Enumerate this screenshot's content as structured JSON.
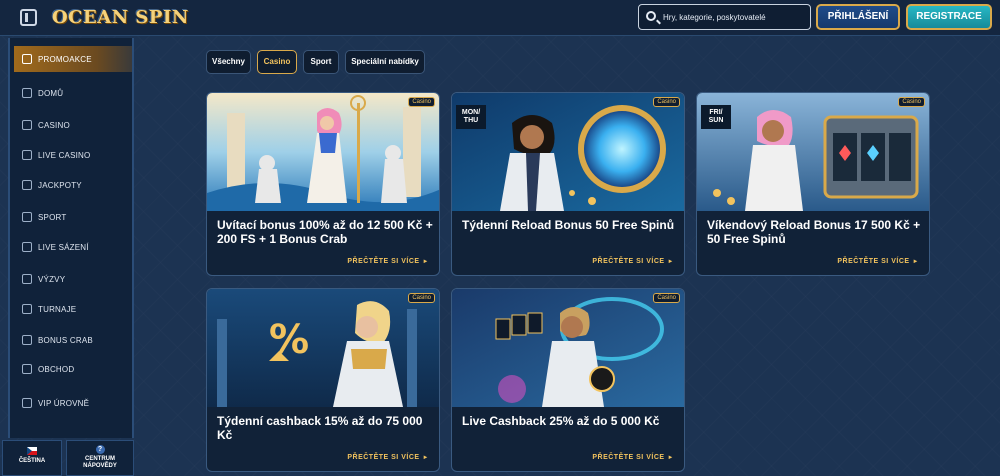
{
  "header": {
    "logo": "OCEAN SPIN",
    "search_placeholder": "Hry, kategorie, poskytovatelé",
    "login_label": "PŘIHLÁŠENÍ",
    "register_label": "REGISTRACE"
  },
  "sidebar": {
    "items": [
      {
        "label": "PROMOAKCE",
        "icon": "gift-icon",
        "active": true
      },
      {
        "label": "DOMŮ",
        "icon": "home-icon"
      },
      {
        "label": "CASINO",
        "icon": "casino-icon"
      },
      {
        "label": "LIVE CASINO",
        "icon": "live-casino-icon"
      },
      {
        "label": "JACKPOTY",
        "icon": "diamond-icon"
      },
      {
        "label": "SPORT",
        "icon": "sport-icon"
      },
      {
        "label": "LIVE SÁZENÍ",
        "icon": "live-betting-icon"
      },
      {
        "label": "VÝZVY",
        "icon": "challenge-icon"
      },
      {
        "label": "TURNAJE",
        "icon": "trophy-icon"
      },
      {
        "label": "BONUS CRAB",
        "icon": "crab-icon"
      },
      {
        "label": "OBCHOD",
        "icon": "shop-icon"
      },
      {
        "label": "VIP ÚROVNĚ",
        "icon": "vip-icon"
      }
    ],
    "language_label": "ČEŠTINA",
    "help_label_1": "CENTRUM",
    "help_label_2": "NÁPOVĚDY",
    "help_icon_glyph": "?"
  },
  "tabs": [
    {
      "label": "Všechny"
    },
    {
      "label": "Casino",
      "active": true
    },
    {
      "label": "Sport"
    },
    {
      "label": "Speciální nabídky"
    }
  ],
  "cards": [
    {
      "title": "Uvítací bonus 100% až do 12 500 Kč + 200 FS + 1 Bonus Crab",
      "badge": "Casino",
      "link": "PŘEČTĚTE SI VÍCE",
      "day": ""
    },
    {
      "title": "Týdenní Reload Bonus 50 Free Spinů",
      "badge": "Casino",
      "link": "PŘEČTĚTE SI VÍCE",
      "day_1": "MON/",
      "day_2": "THU"
    },
    {
      "title": "Víkendový Reload Bonus 17 500 Kč + 50 Free Spinů",
      "badge": "Casino",
      "link": "PŘEČTĚTE SI VÍCE",
      "day_1": "FRI/",
      "day_2": "SUN"
    },
    {
      "title": "Týdenní cashback 15% až do 75 000 Kč",
      "badge": "Casino",
      "link": "PŘEČTĚTE SI VÍCE"
    },
    {
      "title": "Live Cashback 25% až do 5 000 Kč",
      "badge": "Casino",
      "link": "PŘEČTĚTE SI VÍCE"
    }
  ],
  "link_arrow": "►",
  "colors": {
    "accent_gold": "#d9a94a",
    "register_teal": "#27b8c4",
    "background": "#1c3352"
  }
}
